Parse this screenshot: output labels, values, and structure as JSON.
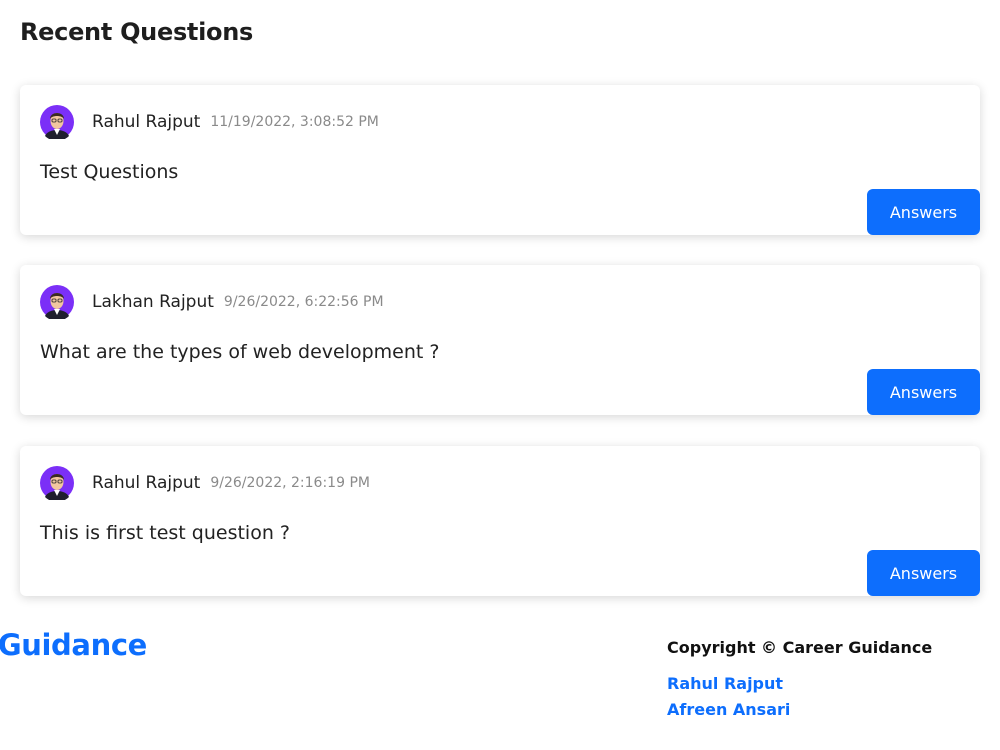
{
  "section": {
    "title": "Recent Questions"
  },
  "questions": [
    {
      "author": "Rahul Rajput",
      "date": "11/19/2022, 3:08:52 PM",
      "text": "Test Questions",
      "button_label": "Answers"
    },
    {
      "author": "Lakhan Rajput",
      "date": "9/26/2022, 6:22:56 PM",
      "text": "What are the types of web development ?",
      "button_label": "Answers"
    },
    {
      "author": "Rahul Rajput",
      "date": "9/26/2022, 2:16:19 PM",
      "text": "This is first test question ?",
      "button_label": "Answers"
    }
  ],
  "footer": {
    "brand": "er Guidance",
    "copyright": "Copyright © Career Guidance",
    "credits": [
      "Rahul Rajput",
      "Afreen Ansari"
    ]
  },
  "colors": {
    "accent": "#0d6efd",
    "avatar_bg": "#7b2ff7"
  },
  "icons": {
    "avatar": "user-avatar-icon"
  }
}
